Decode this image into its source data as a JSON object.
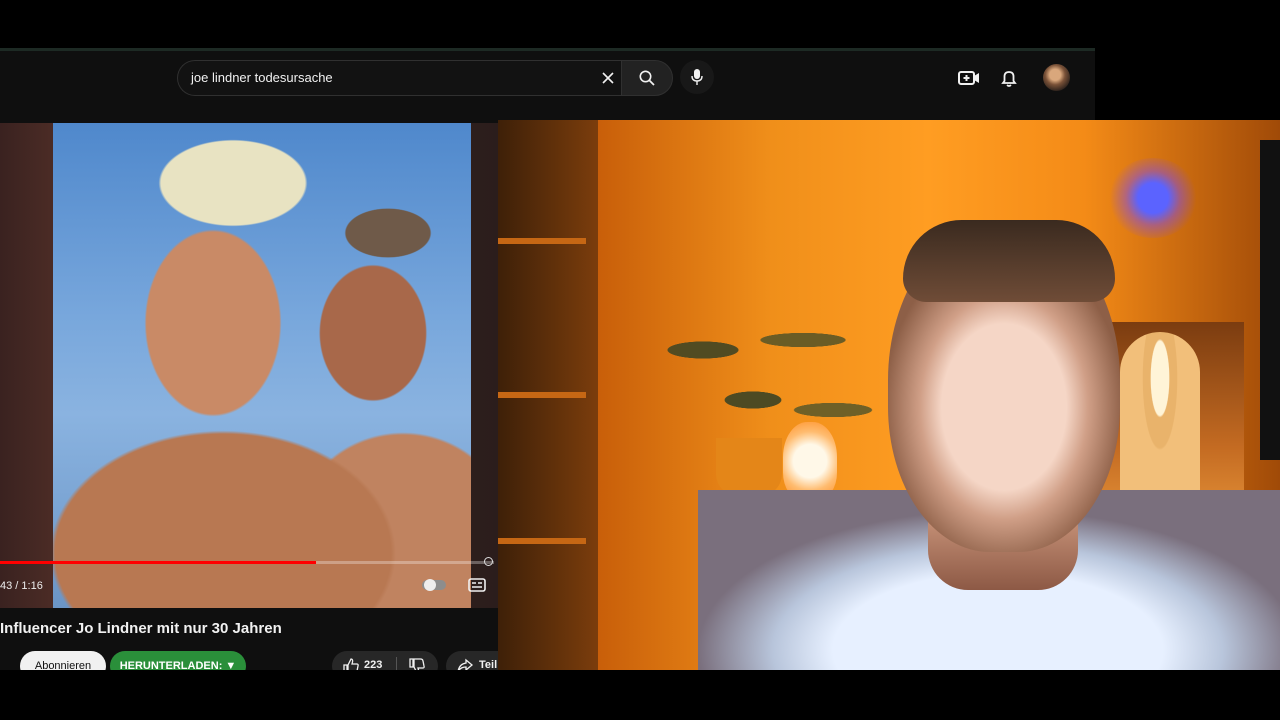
{
  "search": {
    "query": "joe lindner todesursache"
  },
  "player": {
    "time": "43 / 1:16",
    "progress_fraction": 0.64
  },
  "video": {
    "title": "Influencer Jo Lindner mit nur 30 Jahren",
    "subscribe_label": "Abonnieren",
    "download_label": "HERUNTERLADEN: ▼",
    "like_count": "223",
    "share_label": "Teil"
  },
  "colors": {
    "accent_red": "#ff0000",
    "download_green": "#2a8f3a",
    "dark_bg": "#0f0f0f"
  },
  "icons": {
    "clear": "close-icon",
    "search": "search-icon",
    "mic": "mic-icon",
    "create": "create-video-icon",
    "notifications": "bell-icon",
    "like": "thumbs-up-icon",
    "dislike": "thumbs-down-icon",
    "share": "share-icon",
    "subtitles": "subtitles-icon"
  }
}
